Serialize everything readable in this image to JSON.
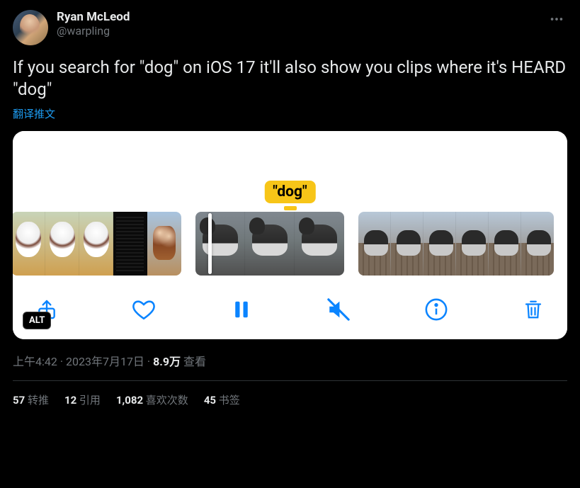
{
  "author": {
    "display_name": "Ryan McLeod",
    "handle": "@warpling"
  },
  "tweet_text": "If you search for \"dog\" on iOS 17 it'll also show you clips where it's HEARD \"dog\"",
  "translate_label": "翻译推文",
  "media": {
    "search_tag": "\"dog\"",
    "alt_badge": "ALT"
  },
  "meta": {
    "time": "上午4:42",
    "date": "2023年7月17日",
    "views_count": "8.9万",
    "views_label": "查看"
  },
  "stats": {
    "retweets_count": "57",
    "retweets_label": "转推",
    "quotes_count": "12",
    "quotes_label": "引用",
    "likes_count": "1,082",
    "likes_label": "喜欢次数",
    "bookmarks_count": "45",
    "bookmarks_label": "书签"
  }
}
